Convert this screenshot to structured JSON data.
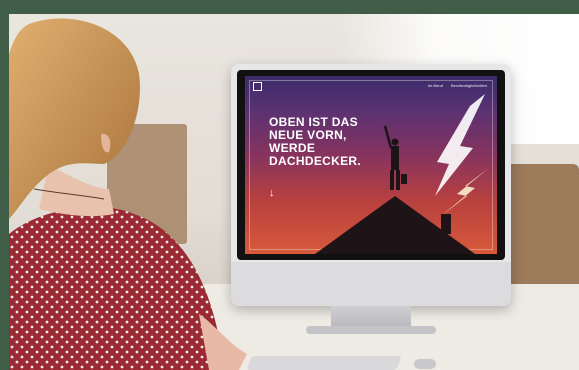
{
  "photo": {
    "description_label": "",
    "colors": {
      "frame": "#3f5d47",
      "screen_top": "#3b2c6b",
      "screen_bottom": "#d8593a",
      "shirt": "#9b2a35",
      "hair": "#c9914f"
    }
  },
  "website": {
    "headline": "OBEN IST DAS NEUE VORN, WERDE DACHDECKER.",
    "nav": [
      "Im Beruf",
      "Berufsmöglichkeiten"
    ],
    "body_copy": "",
    "footer_copy": ""
  },
  "icons": {
    "arrow": "arrow-down-icon",
    "logo": "house-logo-icon",
    "lightning": "lightning-icon"
  }
}
